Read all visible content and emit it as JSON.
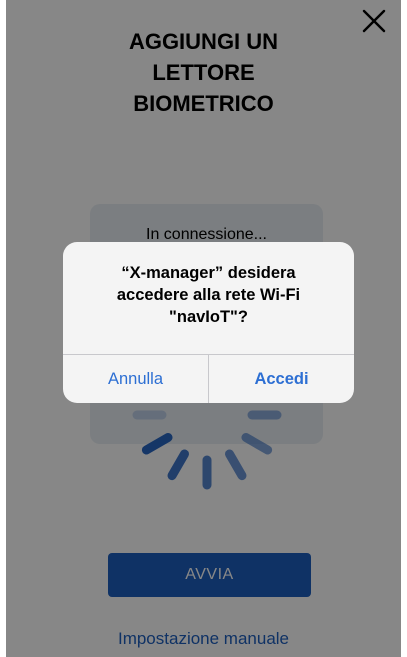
{
  "header": {
    "title_lines": [
      "AGGIUNGI UN",
      "LETTORE",
      "BIOMETRICO"
    ],
    "close_icon": "close-icon"
  },
  "progress": {
    "label": "In connessione...",
    "spinner_icon": "loading-spinner-icon"
  },
  "actions": {
    "start_label": "AVVIA",
    "manual_link_label": "Impostazione manuale"
  },
  "alert": {
    "message_lines": [
      "“X-manager” desidera",
      "accedere alla rete Wi-Fi",
      "\"navIoT\"?"
    ],
    "cancel_label": "Annulla",
    "confirm_label": "Accedi"
  },
  "colors": {
    "accent": "#1e5fbf",
    "alert_button": "#2d6fd3",
    "overlay": "rgba(0,0,0,0.47)"
  }
}
